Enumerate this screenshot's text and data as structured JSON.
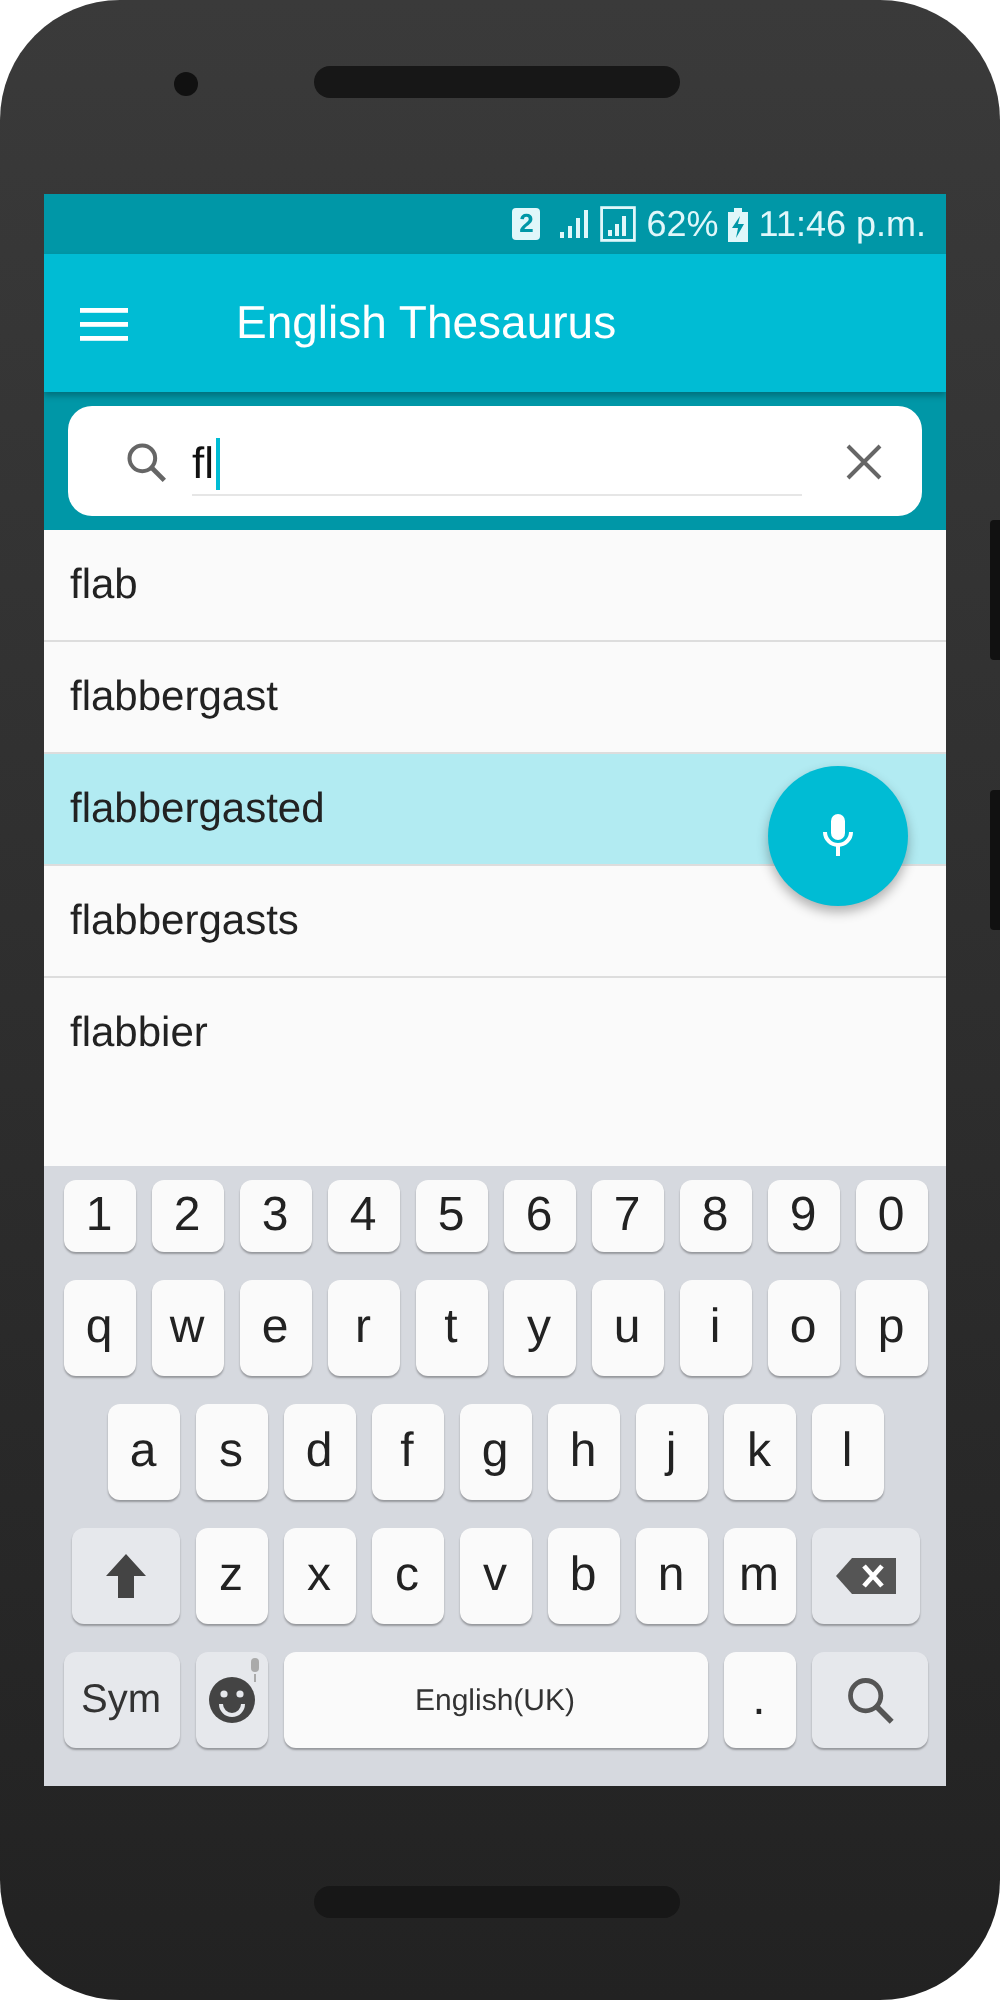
{
  "status_bar": {
    "sim": "2",
    "battery": "62%",
    "time": "11:46 p.m."
  },
  "app_bar": {
    "title": "English Thesaurus"
  },
  "search": {
    "value": "fl"
  },
  "results": [
    {
      "text": "flab",
      "selected": false
    },
    {
      "text": "flabbergast",
      "selected": false
    },
    {
      "text": "flabbergasted",
      "selected": true
    },
    {
      "text": "flabbergasts",
      "selected": false
    },
    {
      "text": "flabbier",
      "selected": false
    }
  ],
  "keyboard": {
    "rows": [
      {
        "keys": [
          {
            "kind": "char",
            "label": "1"
          },
          {
            "kind": "char",
            "label": "2"
          },
          {
            "kind": "char",
            "label": "3"
          },
          {
            "kind": "char",
            "label": "4"
          },
          {
            "kind": "char",
            "label": "5"
          },
          {
            "kind": "char",
            "label": "6"
          },
          {
            "kind": "char",
            "label": "7"
          },
          {
            "kind": "char",
            "label": "8"
          },
          {
            "kind": "char",
            "label": "9"
          },
          {
            "kind": "char",
            "label": "0"
          }
        ]
      },
      {
        "keys": [
          {
            "kind": "char",
            "label": "q"
          },
          {
            "kind": "char",
            "label": "w"
          },
          {
            "kind": "char",
            "label": "e"
          },
          {
            "kind": "char",
            "label": "r"
          },
          {
            "kind": "char",
            "label": "t"
          },
          {
            "kind": "char",
            "label": "y"
          },
          {
            "kind": "char",
            "label": "u"
          },
          {
            "kind": "char",
            "label": "i"
          },
          {
            "kind": "char",
            "label": "o"
          },
          {
            "kind": "char",
            "label": "p"
          }
        ]
      },
      {
        "keys": [
          {
            "kind": "char",
            "label": "a"
          },
          {
            "kind": "char",
            "label": "s"
          },
          {
            "kind": "char",
            "label": "d"
          },
          {
            "kind": "char",
            "label": "f"
          },
          {
            "kind": "char",
            "label": "g"
          },
          {
            "kind": "char",
            "label": "h"
          },
          {
            "kind": "char",
            "label": "j"
          },
          {
            "kind": "char",
            "label": "k"
          },
          {
            "kind": "char",
            "label": "l"
          }
        ]
      },
      {
        "keys": [
          {
            "kind": "shift"
          },
          {
            "kind": "char",
            "label": "z"
          },
          {
            "kind": "char",
            "label": "x"
          },
          {
            "kind": "char",
            "label": "c"
          },
          {
            "kind": "char",
            "label": "v"
          },
          {
            "kind": "char",
            "label": "b"
          },
          {
            "kind": "char",
            "label": "n"
          },
          {
            "kind": "char",
            "label": "m"
          },
          {
            "kind": "backspace"
          }
        ]
      },
      {
        "keys": [
          {
            "kind": "sym",
            "label": "Sym"
          },
          {
            "kind": "emoji"
          },
          {
            "kind": "space",
            "label": "English(UK)"
          },
          {
            "kind": "char",
            "label": "."
          },
          {
            "kind": "search"
          }
        ]
      }
    ]
  }
}
